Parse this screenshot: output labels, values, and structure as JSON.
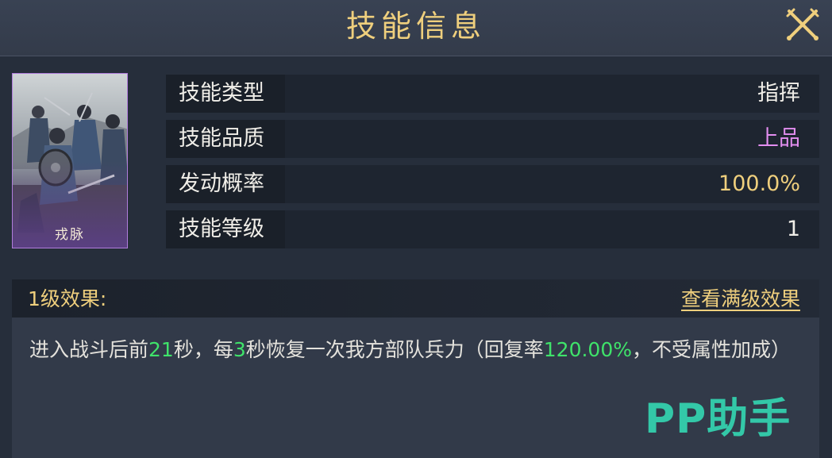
{
  "header": {
    "title": "技能信息"
  },
  "skill_card": {
    "name": "戎脉",
    "rarity_color": "#b07ddc"
  },
  "info_rows": [
    {
      "label": "技能类型",
      "value": "指挥",
      "value_color": "#f0eee8"
    },
    {
      "label": "技能品质",
      "value": "上品",
      "value_color": "#e38ef0"
    },
    {
      "label": "发动概率",
      "value": "100.0%",
      "value_color": "#efcf7d"
    },
    {
      "label": "技能等级",
      "value": "1",
      "value_color": "#f0eee8"
    }
  ],
  "effect": {
    "title": "1级效果:",
    "view_max_link": "查看满级效果",
    "desc": {
      "p1": "进入战斗后前",
      "n1": "21",
      "p2": "秒，每",
      "n2": "3",
      "p3": "秒恢复一次我方部队兵力（回复率",
      "n3": "120.00%",
      "p4": "，不受属性加成）"
    },
    "highlight_color": "#3fe36a"
  },
  "watermark": {
    "text": "PP助手"
  },
  "colors": {
    "gold": "#efcf7d",
    "quality_purple": "#e38ef0",
    "bg": "#272f3d"
  }
}
